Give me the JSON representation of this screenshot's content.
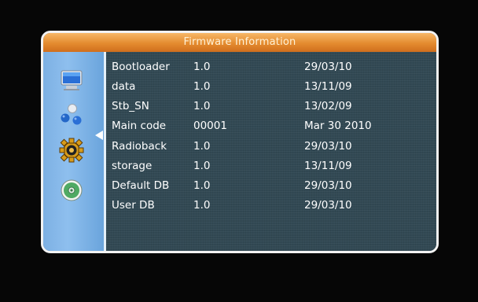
{
  "window": {
    "title": "Firmware Information"
  },
  "sidebar": {
    "items": [
      {
        "icon": "monitor-icon"
      },
      {
        "icon": "balls-icon"
      },
      {
        "icon": "settings-gear-icon"
      },
      {
        "icon": "disc-icon"
      }
    ]
  },
  "table": {
    "rows": [
      {
        "name": "Bootloader",
        "version": "1.0",
        "date": "29/03/10"
      },
      {
        "name": "data",
        "version": "1.0",
        "date": "13/11/09"
      },
      {
        "name": "Stb_SN",
        "version": "1.0",
        "date": "13/02/09"
      },
      {
        "name": "Main code",
        "version": "00001",
        "date": "Mar 30 2010"
      },
      {
        "name": "Radioback",
        "version": "1.0",
        "date": "29/03/10"
      },
      {
        "name": "storage",
        "version": "1.0",
        "date": "13/11/09"
      },
      {
        "name": "Default DB",
        "version": "1.0",
        "date": "29/03/10"
      },
      {
        "name": "User DB",
        "version": "1.0",
        "date": "29/03/10"
      }
    ]
  }
}
